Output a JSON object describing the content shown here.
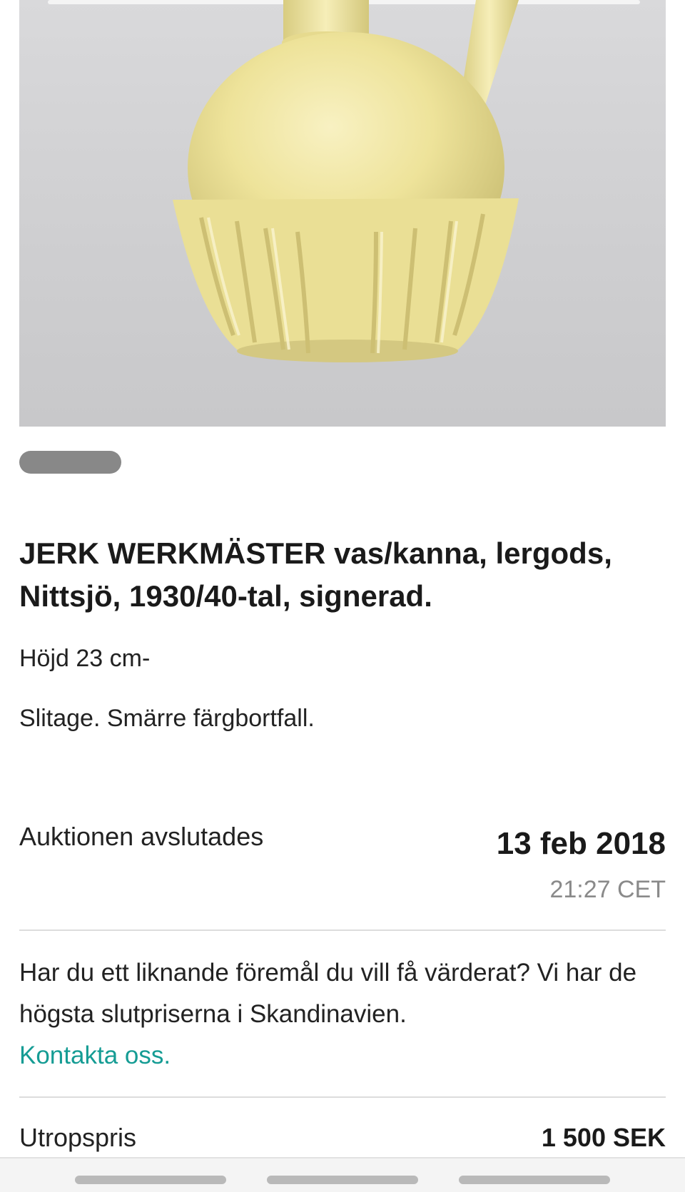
{
  "item": {
    "title_maker": "JERK WERKMÄSTER",
    "title_rest": " vas/kanna, lergods, Nittsjö, 1930/40-tal, signerad.",
    "height_text": "Höjd 23 cm-",
    "condition_text": "Slitage. Smärre färgbortfall."
  },
  "auction": {
    "end_label": "Auktionen avslutades",
    "end_date": "13 feb 2018",
    "end_time": "21:27 CET"
  },
  "valuation": {
    "text": "Har du ett liknande föremål du vill få värderat? Vi har de högsta slutpriserna i Skandinavien.",
    "link": "Kontakta oss."
  },
  "price": {
    "label": "Utropspris",
    "value": "1 500 SEK"
  },
  "colors": {
    "accent": "#159c94",
    "vase": "#efe49a"
  }
}
